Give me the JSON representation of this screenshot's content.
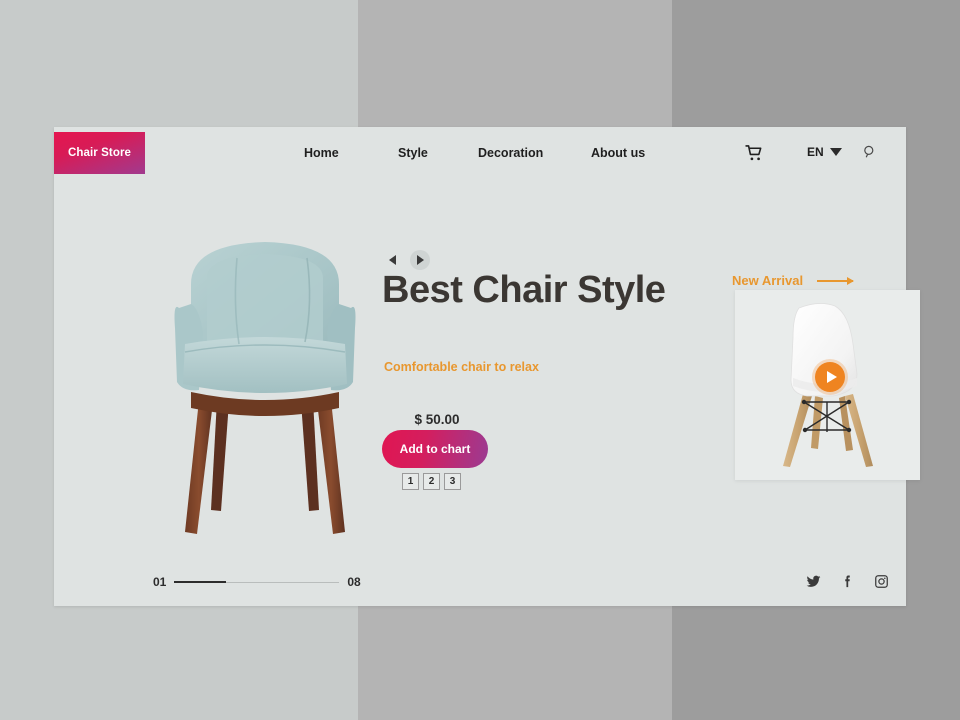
{
  "background": {
    "band_left_color": "#c7cbca",
    "band_mid_color": "#b4b4b4",
    "band_right_color": "#9d9d9d"
  },
  "navbar": {
    "logo": "Chair Store",
    "links": [
      {
        "label": "Home"
      },
      {
        "label": "Style"
      },
      {
        "label": "Decoration"
      },
      {
        "label": "About us"
      }
    ],
    "cart_icon": "shopping-cart-icon",
    "language": "EN",
    "language_caret": "chevron-down-icon",
    "search_icon": "search-icon"
  },
  "hero": {
    "prev_icon": "chevron-left-icon",
    "next_icon": "chevron-right-icon",
    "headline": "Best Chair Style",
    "subheadline": "Comfortable chair to relax",
    "price": "$ 50.00",
    "add_button": "Add to chart",
    "quantities": [
      "1",
      "2",
      "3"
    ],
    "chair_image_alt": "light-blue-armchair-with-wooden-legs"
  },
  "new_arrival": {
    "label": "New Arrival",
    "arrow_icon": "arrow-right-icon",
    "play_icon": "play-icon",
    "card_image_alt": "white-eames-style-chair-with-wooden-legs"
  },
  "footer": {
    "slide_current": "01",
    "slide_total": "08",
    "socials": [
      {
        "name": "twitter-icon"
      },
      {
        "name": "facebook-icon"
      },
      {
        "name": "instagram-icon"
      }
    ]
  },
  "colors": {
    "brand_pink": "#e01652",
    "brand_purple": "#9b3b92",
    "accent_orange": "#e8972f",
    "play_orange": "#ef8420",
    "heading_dark": "#3b3733",
    "page_bg": "#dfe3e2"
  }
}
